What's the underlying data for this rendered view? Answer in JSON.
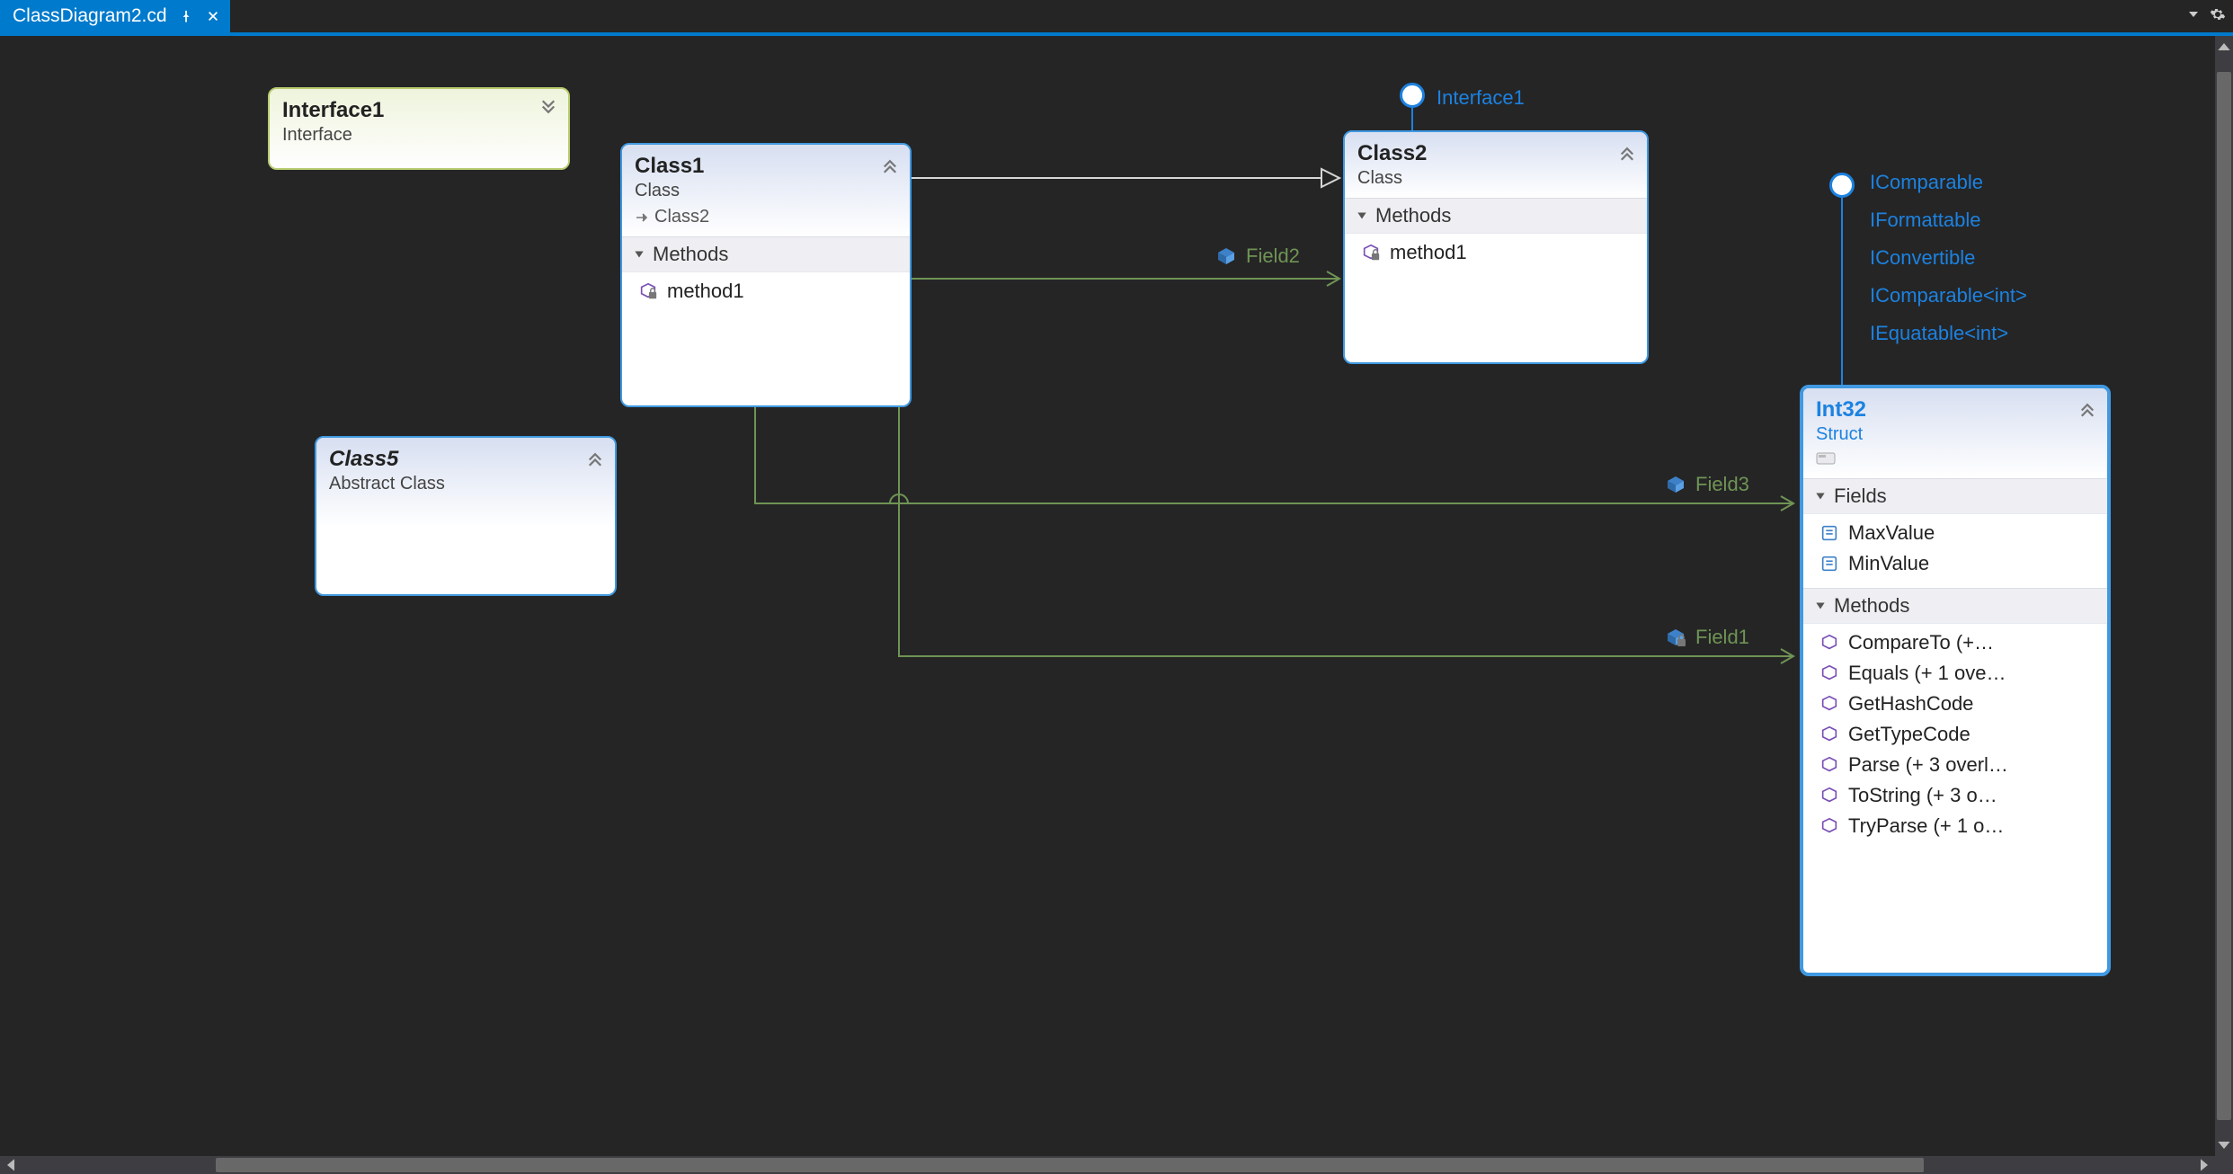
{
  "tab": {
    "title": "ClassDiagram2.cd"
  },
  "shapes": {
    "interface1": {
      "title": "Interface1",
      "subtitle": "Interface"
    },
    "class1": {
      "title": "Class1",
      "subtitle": "Class",
      "derived": "Class2",
      "section1": "Methods",
      "methods": [
        "method1"
      ]
    },
    "class2": {
      "title": "Class2",
      "subtitle": "Class",
      "section1": "Methods",
      "methods": [
        "method1"
      ],
      "implements_label": "Interface1"
    },
    "class5": {
      "title": "Class5",
      "subtitle": "Abstract Class"
    },
    "int32": {
      "title": "Int32",
      "subtitle": "Struct",
      "fields_label": "Fields",
      "fields": [
        "MaxValue",
        "MinValue"
      ],
      "methods_label": "Methods",
      "methods": [
        "CompareTo  (+…",
        "Equals (+ 1 ove…",
        "GetHashCode",
        "GetTypeCode",
        "Parse (+ 3 overl…",
        "ToString (+ 3 o…",
        "TryParse (+ 1 o…"
      ],
      "implements": [
        "IComparable",
        "IFormattable",
        "IConvertible",
        "IComparable<int>",
        "IEquatable<int>"
      ]
    }
  },
  "assoc": {
    "field2": "Field2",
    "field3": "Field3",
    "field1": "Field1"
  }
}
